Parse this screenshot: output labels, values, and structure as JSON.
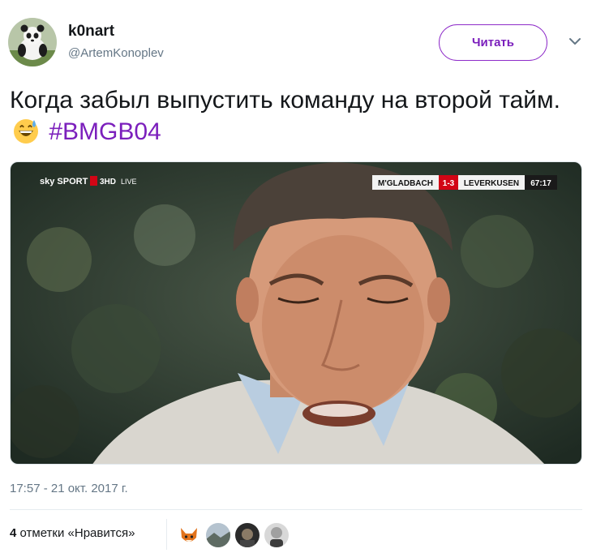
{
  "author": {
    "display_name": "k0nart",
    "handle": "@ArtemKonoplev",
    "avatar_icon": "panda-avatar-icon"
  },
  "follow_button": {
    "label": "Читать",
    "color": "#7b1fbc"
  },
  "menu_icon": "chevron-down-icon",
  "tweet": {
    "text": "Когда забыл выпустить команду на второй тайм.",
    "emoji": "grinning-sweat-emoji",
    "hashtag": "#BMGB04"
  },
  "media": {
    "broadcaster": "sky SPORT",
    "channel": "3HD",
    "live": "LIVE",
    "home_team": "M'GLADBACH",
    "score": "1-3",
    "away_team": "LEVERKUSEN",
    "clock": "67:17"
  },
  "timestamp": "17:57 - 21 окт. 2017 г.",
  "likes": {
    "count": "4",
    "label": "отметки «Нравится»"
  },
  "likers": [
    "liker-avatar-fox",
    "liker-avatar-landscape",
    "liker-avatar-dark",
    "liker-avatar-man"
  ]
}
